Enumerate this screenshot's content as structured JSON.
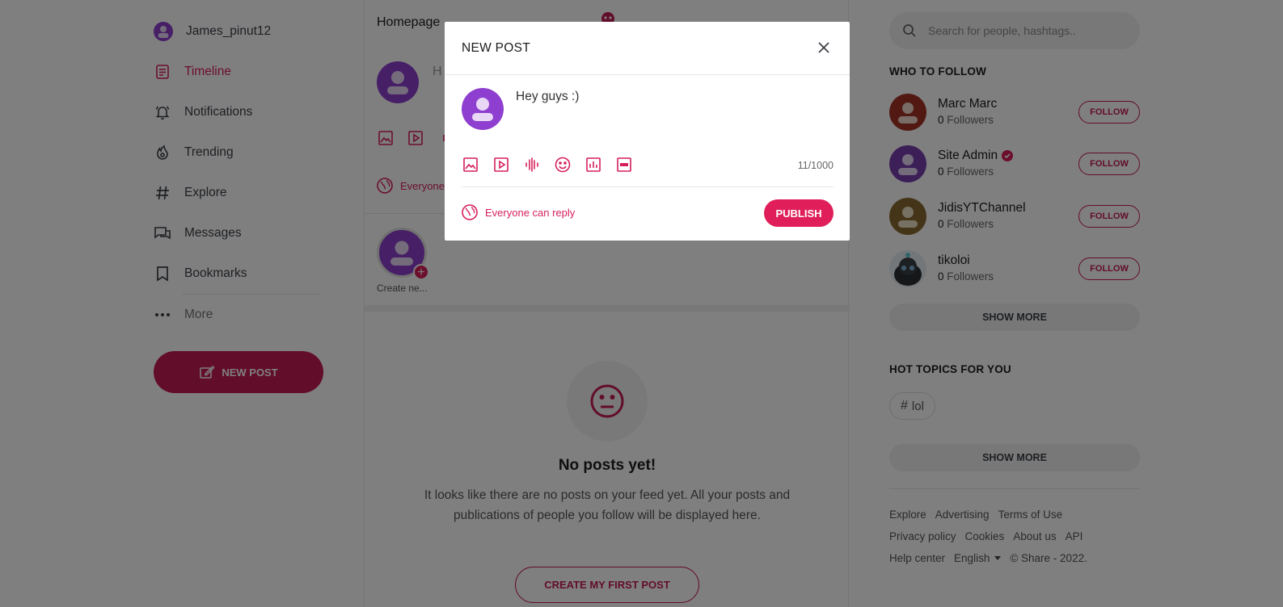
{
  "sidebar": {
    "username": "James_pinut12",
    "items": [
      {
        "label": "Timeline"
      },
      {
        "label": "Notifications"
      },
      {
        "label": "Trending"
      },
      {
        "label": "Explore"
      },
      {
        "label": "Messages"
      },
      {
        "label": "Bookmarks"
      },
      {
        "label": "More"
      }
    ],
    "new_post_label": "NEW POST"
  },
  "feed": {
    "page_title": "Homepage",
    "compose_placeholder": "H",
    "reply_label": "Everyone",
    "story_label": "Create ne...",
    "empty_title": "No posts yet!",
    "empty_text": "It looks like there are no posts on your feed yet. All your posts and publications of people you follow will be displayed here.",
    "first_post_label": "CREATE MY FIRST POST"
  },
  "right": {
    "search_placeholder": "Search for people, hashtags..",
    "who_to_follow_title": "WHO TO FOLLOW",
    "follow_label": "FOLLOW",
    "suggestions": [
      {
        "name": "Marc Marc",
        "count": "0",
        "followers_label": "Followers",
        "avatar_color": "#a33223",
        "verified": false
      },
      {
        "name": "Site Admin",
        "count": "0",
        "followers_label": "Followers",
        "avatar_color": "#7a3fb0",
        "verified": true
      },
      {
        "name": "JidisYTChannel",
        "count": "0",
        "followers_label": "Followers",
        "avatar_color": "#8a6a30",
        "verified": false
      },
      {
        "name": "tikoloi",
        "count": "0",
        "followers_label": "Followers",
        "avatar_color": "#2b2f33",
        "verified": false
      }
    ],
    "show_more_label": "SHOW MORE",
    "hot_topics_title": "HOT TOPICS FOR YOU",
    "topics": [
      {
        "tag": "lol"
      }
    ],
    "footer": {
      "row1": [
        "Explore",
        "Advertising",
        "Terms of Use"
      ],
      "row2": [
        "Privacy policy",
        "Cookies",
        "About us",
        "API"
      ],
      "help": "Help center",
      "language": "English",
      "copyright": "© Share - 2022."
    }
  },
  "modal": {
    "title": "NEW POST",
    "text_value": "Hey guys :)",
    "char_count": "11/1000",
    "reply_setting": "Everyone can reply",
    "publish_label": "PUBLISH"
  },
  "colors": {
    "accent": "#d61f5a",
    "accent_dark": "#c51a52",
    "avatar_purple": "#8e3fcf"
  }
}
